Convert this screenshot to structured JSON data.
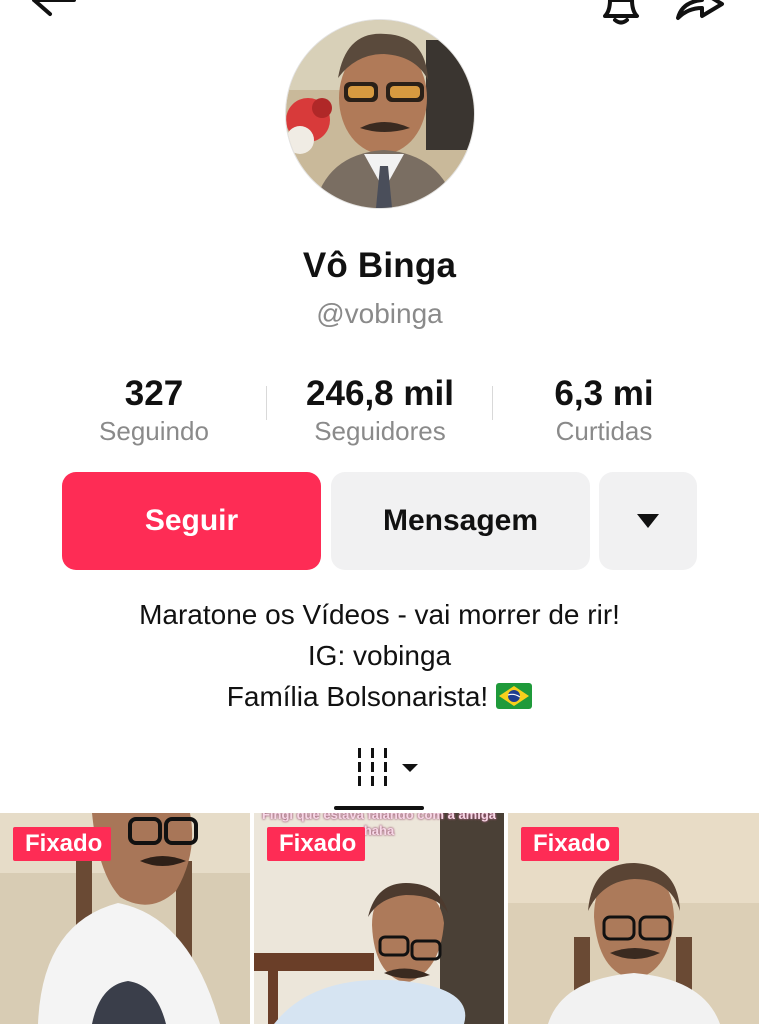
{
  "header": {
    "back_icon": "arrow-left-icon",
    "notification_icon": "bell-icon",
    "share_icon": "share-arrow-icon"
  },
  "profile": {
    "display_name": "Vô Binga",
    "username": "@vobinga"
  },
  "stats": [
    {
      "value": "327",
      "label": "Seguindo"
    },
    {
      "value": "246,8 mil",
      "label": "Seguidores"
    },
    {
      "value": "6,3 mi",
      "label": "Curtidas"
    }
  ],
  "actions": {
    "follow_label": "Seguir",
    "message_label": "Mensagem",
    "more_icon": "triangle-down-icon"
  },
  "bio": {
    "line1": "Maratone os Vídeos - vai morrer de rir!",
    "line2": "IG: vobinga",
    "line3": "Família Bolsonarista!",
    "line3_emoji": "brazil-flag"
  },
  "tabs": {
    "active_icon": "grid-icon"
  },
  "videos": [
    {
      "badge": "Fixado",
      "caption": ""
    },
    {
      "badge": "Fixado",
      "caption": "Fingi que estava falando com a amiga haha"
    },
    {
      "badge": "Fixado",
      "caption": ""
    }
  ],
  "colors": {
    "accent": "#fe2c55",
    "secondary_button": "#f1f1f2",
    "muted_text": "#8a8a8a"
  }
}
